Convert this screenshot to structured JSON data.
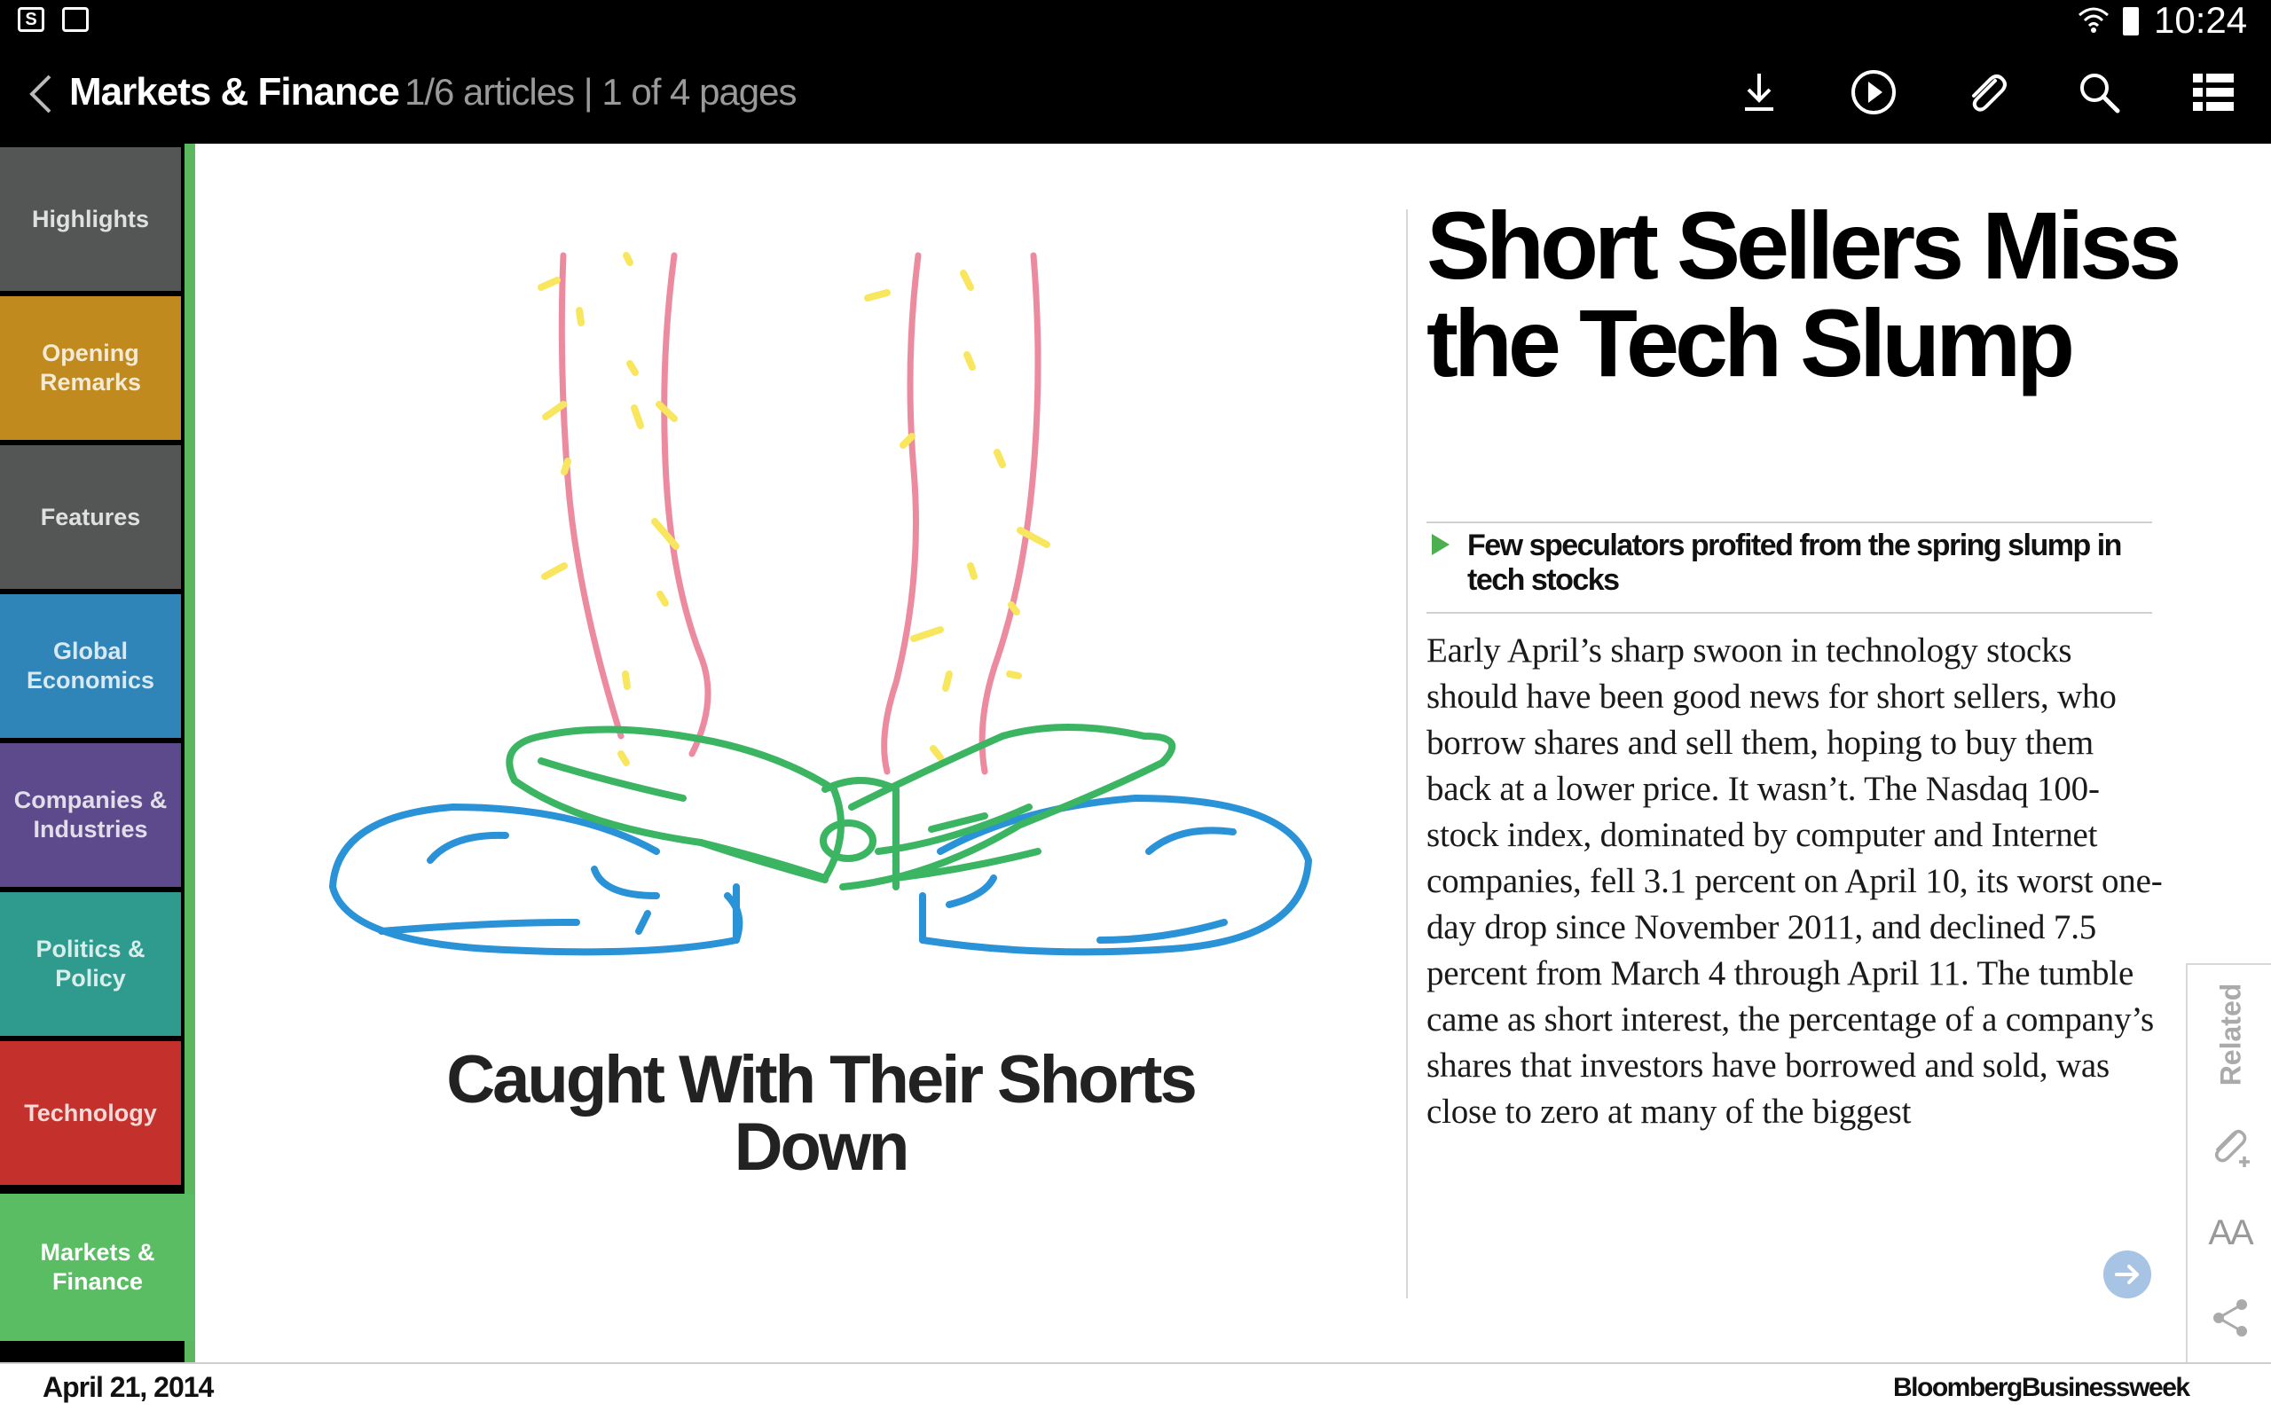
{
  "status_bar": {
    "time": "10:24"
  },
  "action_bar": {
    "section_title": "Markets & Finance",
    "section_meta": "1/6 articles | 1 of 4 pages"
  },
  "sidebar": {
    "items": [
      {
        "label": "Highlights",
        "color": "#545656"
      },
      {
        "label": "Opening Remarks",
        "color": "#c08a1e"
      },
      {
        "label": "Features",
        "color": "#545656"
      },
      {
        "label": "Global Economics",
        "color": "#2f84b8"
      },
      {
        "label": "Companies & Industries",
        "color": "#5c4a8d"
      },
      {
        "label": "Politics & Policy",
        "color": "#2f9b8e"
      },
      {
        "label": "Technology",
        "color": "#c4302b"
      },
      {
        "label": "Markets & Finance",
        "color": "#5bbd63"
      }
    ]
  },
  "illustration": {
    "title": "Caught With Their Shorts Down",
    "colors": {
      "legs": "#ec8aa0",
      "shorts": "#3cb563",
      "shoes": "#2a92d6",
      "hair": "#f7e65e"
    }
  },
  "article": {
    "headline": "Short Sellers Miss the Tech Slump",
    "dek": "Few speculators profited from the spring slump in tech stocks",
    "body": "Early April’s sharp swoon in technology stocks should have been good news for short sellers, who borrow shares and sell them, hoping to buy them back at a lower price. It wasn’t. The Nasdaq 100-stock index, dominated by computer and Internet companies, fell 3.1 percent on April 10, its worst one-day drop since November 2011, and declined 7.5 percent from March 4 through April 11. The tumble came as short interest, the percentage of a company’s shares that investors have borrowed and sold, was close to zero at many of the biggest"
  },
  "toolstrip": {
    "related_label": "Related",
    "font_size_label": "AA"
  },
  "footer": {
    "date": "April 21, 2014",
    "brand": "BloombergBusinessweek"
  }
}
